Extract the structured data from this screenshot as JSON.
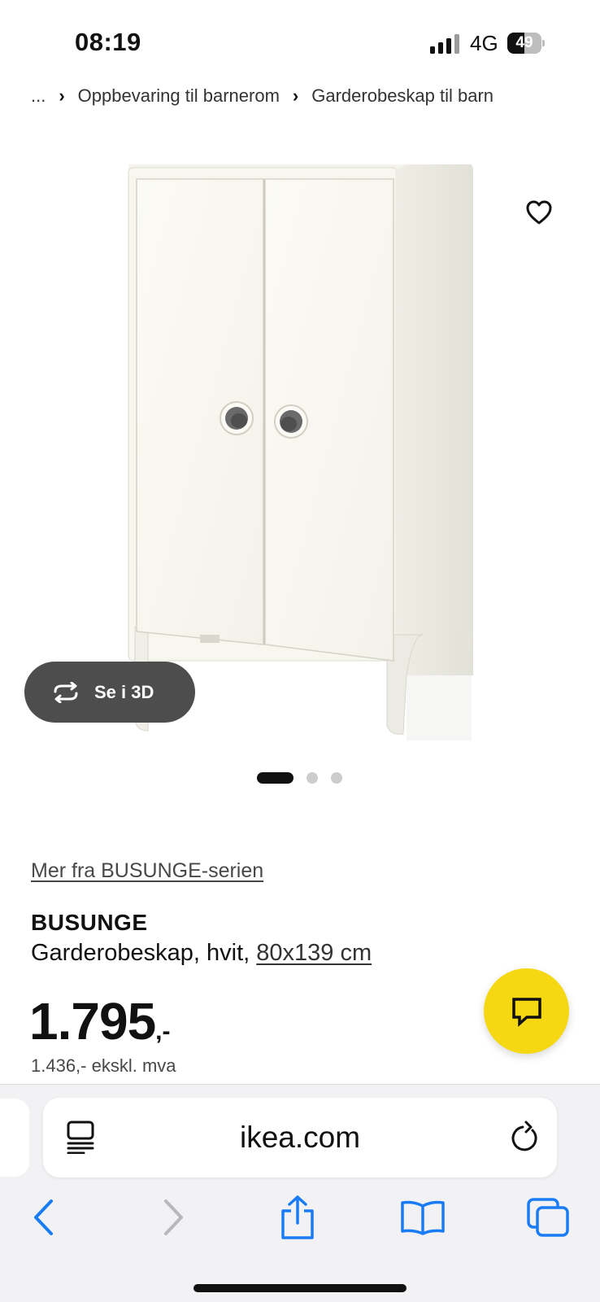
{
  "status_bar": {
    "time": "08:19",
    "network": "4G",
    "battery": "49",
    "battery_level": 0.49
  },
  "breadcrumb": {
    "items": [
      "...",
      "Oppbevaring til barnerom",
      "Garderobeskap til barn"
    ]
  },
  "gallery": {
    "view_3d_label": "Se i 3D",
    "slide_count": 3,
    "active_slide": 0
  },
  "product": {
    "series_link": "Mer fra BUSUNGE-serien",
    "name": "BUSUNGE",
    "description": "Garderobeskap, hvit,",
    "dimensions": "80x139 cm",
    "price": "1.795",
    "price_suffix": ",-",
    "price_ex_vat": "1.436,- ekskl. mva"
  },
  "browser": {
    "url": "ikea.com"
  },
  "colors": {
    "accent_yellow": "#f5d811",
    "safari_blue": "#1a7cf5",
    "button_dark": "#4d4d4d"
  },
  "icons": [
    "heart-icon",
    "rotate-3d-icon",
    "chat-icon",
    "reader-icon",
    "reload-icon",
    "back-icon",
    "forward-icon",
    "share-icon",
    "bookmarks-icon",
    "tabs-icon"
  ]
}
